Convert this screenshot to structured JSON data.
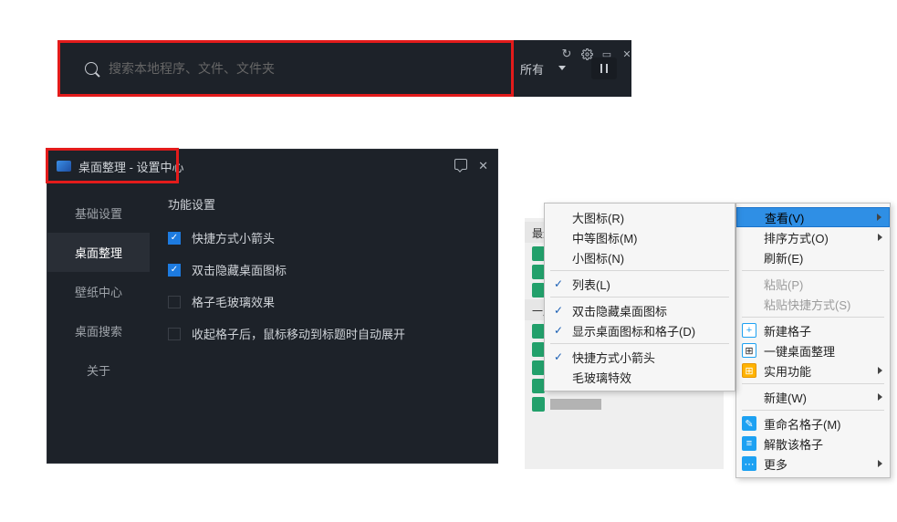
{
  "searchbar": {
    "placeholder": "搜索本地程序、文件、文件夹",
    "filter_label": "所有"
  },
  "settings": {
    "title": "桌面整理 - 设置中心",
    "nav": [
      "基础设置",
      "桌面整理",
      "壁纸中心",
      "桌面搜索",
      "关于"
    ],
    "active_nav_index": 1,
    "section_title": "功能设置",
    "options": [
      {
        "label": "快捷方式小箭头",
        "checked": true
      },
      {
        "label": "双击隐藏桌面图标",
        "checked": true
      },
      {
        "label": "格子毛玻璃效果",
        "checked": false
      },
      {
        "label": "收起格子后，鼠标移动到标题时自动展开",
        "checked": false
      }
    ]
  },
  "view_submenu": {
    "items": [
      {
        "label": "大图标(R)",
        "checked": false
      },
      {
        "label": "中等图标(M)",
        "checked": false
      },
      {
        "label": "小图标(N)",
        "checked": false
      },
      {
        "sep": true
      },
      {
        "label": "列表(L)",
        "checked": true
      },
      {
        "sep": true
      },
      {
        "label": "双击隐藏桌面图标",
        "checked": true
      },
      {
        "label": "显示桌面图标和格子(D)",
        "checked": true
      },
      {
        "sep": true
      },
      {
        "label": "快捷方式小箭头",
        "checked": true
      },
      {
        "label": "毛玻璃特效",
        "checked": false
      }
    ]
  },
  "context_menu": {
    "items": [
      {
        "label": "查看(V)",
        "arrow": true,
        "highlight": true
      },
      {
        "label": "排序方式(O)",
        "arrow": true
      },
      {
        "label": "刷新(E)"
      },
      {
        "sep": true
      },
      {
        "label": "粘贴(P)",
        "disabled": true
      },
      {
        "label": "粘贴快捷方式(S)",
        "disabled": true
      },
      {
        "sep": true
      },
      {
        "label": "新建格子",
        "icon": "blue-plus"
      },
      {
        "label": "一键桌面整理",
        "icon": "grid4"
      },
      {
        "label": "实用功能",
        "icon": "apps",
        "arrow": true
      },
      {
        "sep": true
      },
      {
        "label": "新建(W)",
        "arrow": true
      },
      {
        "sep": true
      },
      {
        "label": "重命名格子(M)",
        "icon": "edit"
      },
      {
        "label": "解散该格子",
        "icon": "list"
      },
      {
        "label": "更多",
        "icon": "more",
        "arrow": true
      }
    ]
  },
  "filelist": {
    "group_labels": [
      "最近",
      "一周"
    ]
  }
}
